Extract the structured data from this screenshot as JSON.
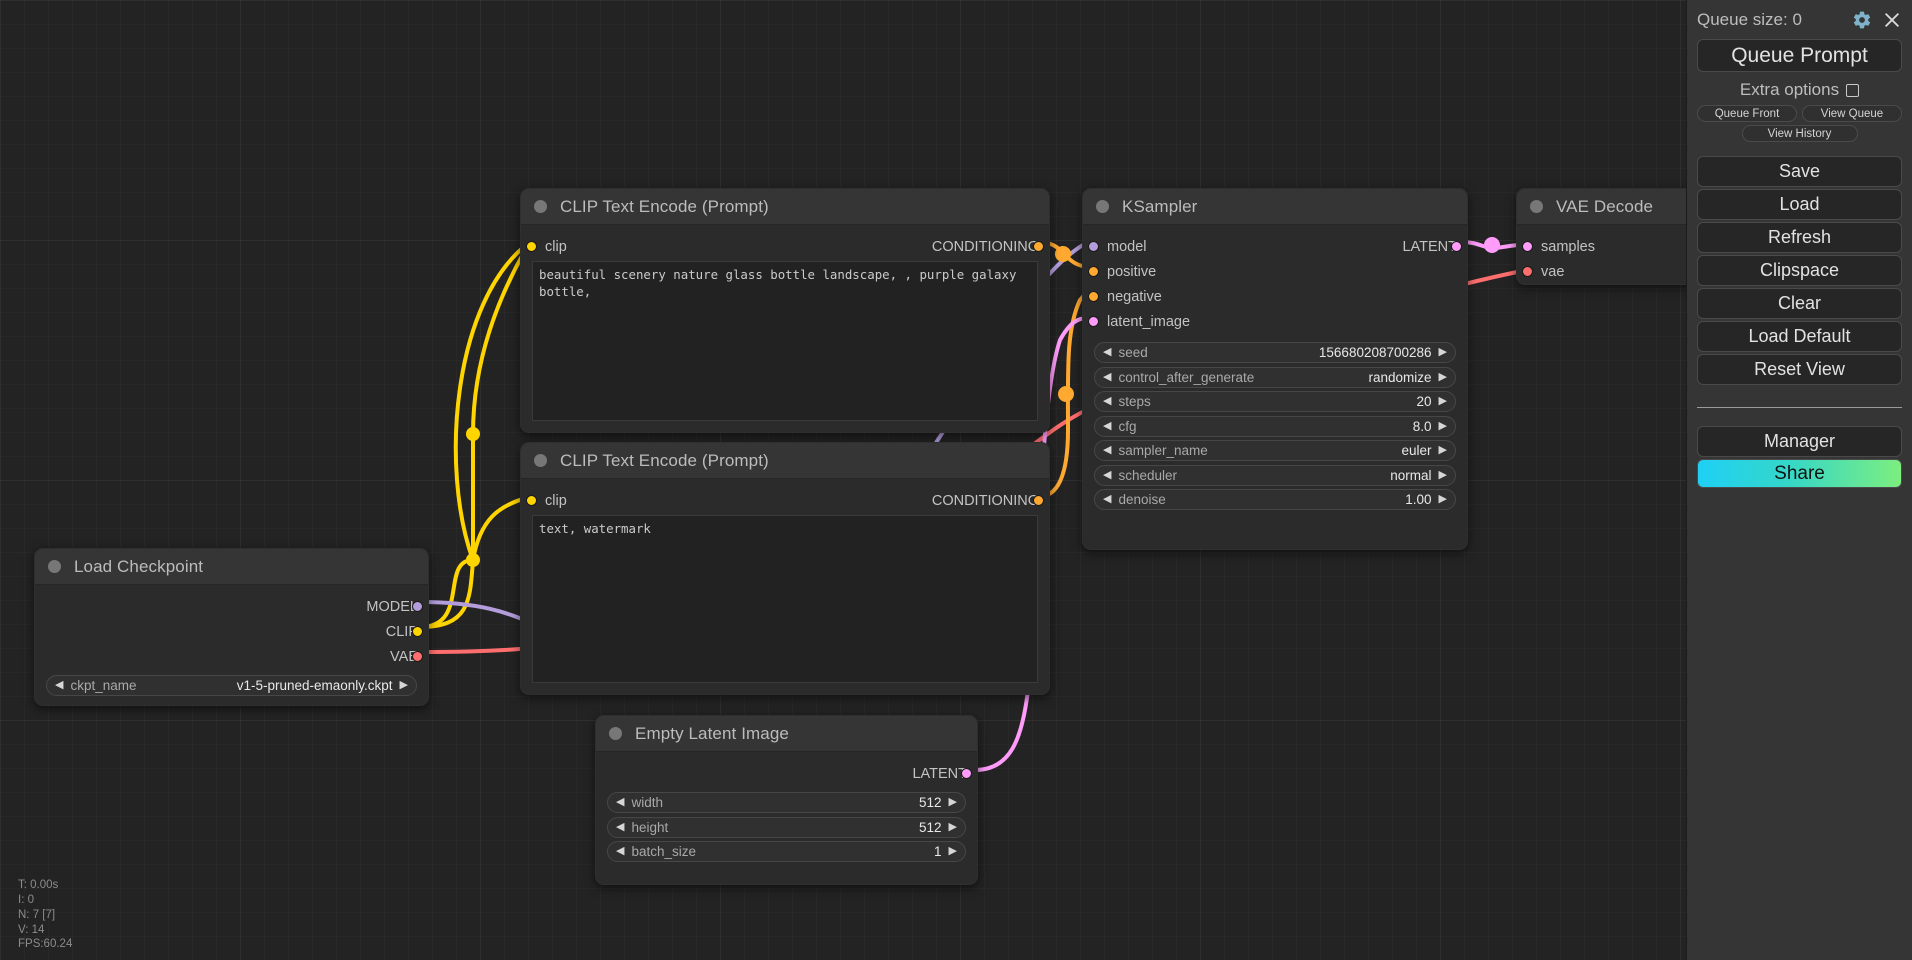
{
  "sidebar": {
    "queue_size_label": "Queue size: 0",
    "gear_icon": "gear-icon",
    "close_icon": "close-icon",
    "queue_prompt_label": "Queue Prompt",
    "extra_options_label": "Extra options",
    "queue_front_label": "Queue Front",
    "view_queue_label": "View Queue",
    "view_history_label": "View History",
    "buttons": [
      {
        "label": "Save"
      },
      {
        "label": "Load"
      },
      {
        "label": "Refresh"
      },
      {
        "label": "Clipspace"
      },
      {
        "label": "Clear"
      },
      {
        "label": "Load Default"
      },
      {
        "label": "Reset View"
      }
    ],
    "manager_label": "Manager",
    "share_label": "Share",
    "share_gradient_from": "#1FD0F5",
    "share_gradient_to": "#7DEE7F"
  },
  "stats": {
    "time": "T: 0.00s",
    "iterations": "I: 0",
    "nodes": "N: 7 [7]",
    "vertices": "V: 14",
    "fps": "FPS:60.24"
  },
  "nodes": {
    "clip_positive": {
      "title": "CLIP Text Encode (Prompt)",
      "input_label": "clip",
      "output_label": "CONDITIONING",
      "text": "beautiful scenery nature glass bottle landscape, , purple galaxy bottle,"
    },
    "clip_negative": {
      "title": "CLIP Text Encode (Prompt)",
      "input_label": "clip",
      "output_label": "CONDITIONING",
      "text": "text, watermark"
    },
    "ksampler": {
      "title": "KSampler",
      "inputs": [
        {
          "label": "model"
        },
        {
          "label": "positive"
        },
        {
          "label": "negative"
        },
        {
          "label": "latent_image"
        }
      ],
      "output_label": "LATENT",
      "widgets": [
        {
          "name": "seed",
          "value": "156680208700286"
        },
        {
          "name": "control_after_generate",
          "value": "randomize"
        },
        {
          "name": "steps",
          "value": "20"
        },
        {
          "name": "cfg",
          "value": "8.0"
        },
        {
          "name": "sampler_name",
          "value": "euler"
        },
        {
          "name": "scheduler",
          "value": "normal"
        },
        {
          "name": "denoise",
          "value": "1.00"
        }
      ]
    },
    "vae_decode": {
      "title": "VAE Decode",
      "inputs": [
        {
          "label": "samples"
        },
        {
          "label": "vae"
        }
      ]
    },
    "load_checkpoint": {
      "title": "Load Checkpoint",
      "outputs": [
        {
          "label": "MODEL"
        },
        {
          "label": "CLIP"
        },
        {
          "label": "VAE"
        }
      ],
      "widgets": [
        {
          "name": "ckpt_name",
          "value": "v1-5-pruned-emaonly.ckpt"
        }
      ]
    },
    "empty_latent": {
      "title": "Empty Latent Image",
      "output_label": "LATENT",
      "widgets": [
        {
          "name": "width",
          "value": "512"
        },
        {
          "name": "height",
          "value": "512"
        },
        {
          "name": "batch_size",
          "value": "1"
        }
      ]
    }
  },
  "link_colors": {
    "clip": "#FFD500",
    "conditioning": "#FFA931",
    "model": "#B39DDB",
    "latent": "#FF9CF9",
    "vae": "#FF6E6E"
  },
  "widget_arrows": {
    "left": "◀",
    "right": "▶"
  }
}
